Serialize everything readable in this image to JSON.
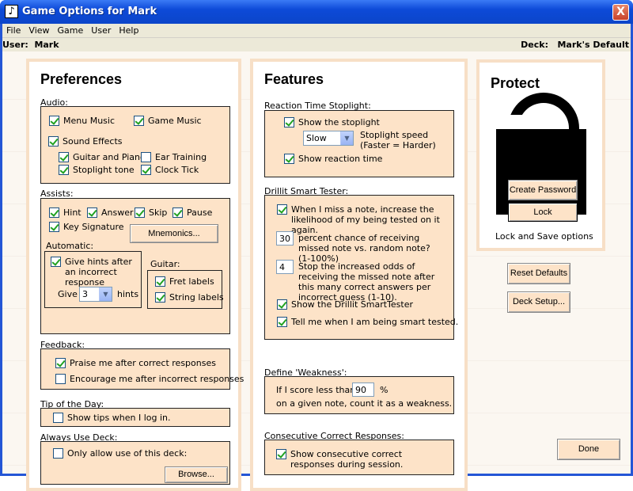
{
  "window": {
    "title": "Game Options for Mark",
    "icon": "app-icon",
    "close_label": "X"
  },
  "menu": [
    "File",
    "View",
    "Game",
    "User",
    "Help"
  ],
  "userbar": {
    "user_label": "User:",
    "user": "Mark",
    "deck_label": "Deck:",
    "deck": "Mark's Default"
  },
  "preferences": {
    "title": "Preferences",
    "audio": {
      "label": "Audio:",
      "menu_music": "Menu Music",
      "game_music": "Game Music",
      "sound_effects": "Sound Effects",
      "guitar_piano": "Guitar and Piano",
      "ear_training": "Ear Training",
      "stoplight_tone": "Stoplight tone",
      "clock_tick": "Clock Tick"
    },
    "assists": {
      "label": "Assists:",
      "hint": "Hint",
      "answer": "Answer",
      "skip": "Skip",
      "pause": "Pause",
      "key_signature": "Key Signature",
      "mnemonics": "Mnemonics..."
    },
    "automatic": {
      "label": "Automatic:",
      "give_hints": "Give hints after an incorrect response",
      "give": "Give",
      "hints_value": "3",
      "hints": "hints"
    },
    "guitar": {
      "label": "Guitar:",
      "fret_labels": "Fret labels",
      "string_labels": "String labels"
    },
    "feedback": {
      "label": "Feedback:",
      "praise": "Praise me after correct responses",
      "encourage": "Encourage me after incorrect responses"
    },
    "tip": {
      "label": "Tip of the Day:",
      "show_tips": "Show tips when I log in."
    },
    "deck": {
      "label": "Always Use Deck:",
      "only_allow": "Only allow use of this deck:",
      "browse": "Browse..."
    }
  },
  "features": {
    "title": "Features",
    "stoplight": {
      "label": "Reaction Time Stoplight:",
      "show_stoplight": "Show the stoplight",
      "speed_value": "Slow",
      "speed_label_1": "Stoplight speed",
      "speed_label_2": "(Faster = Harder)",
      "show_reaction": "Show reaction time"
    },
    "tester": {
      "label": "Drillit Smart Tester:",
      "miss_note": "When I miss a note, increase the likelihood of my being tested on it again.",
      "percent_value": "30",
      "percent_text": "percent chance of receiving missed note vs. random note? (1-100%)",
      "stop_value": "4",
      "stop_text": "Stop the increased odds of receiving the missed note after this many correct answers per incorrect guess (1-10).",
      "show_tester": "Show the Drillit SmartTester",
      "tell_me": "Tell me when I am being smart tested."
    },
    "weakness": {
      "label": "Define 'Weakness':",
      "line1": "If I score less than",
      "value": "90",
      "pct": "%",
      "line2": "on a given note, count it as a weakness."
    },
    "consecutive": {
      "label": "Consecutive Correct Responses:",
      "show": "Show consecutive correct responses during session."
    }
  },
  "protect": {
    "title": "Protect",
    "create_password": "Create Password",
    "lock": "Lock",
    "caption": "Lock and Save options"
  },
  "buttons": {
    "reset": "Reset Defaults",
    "deck_setup": "Deck Setup...",
    "done": "Done"
  }
}
